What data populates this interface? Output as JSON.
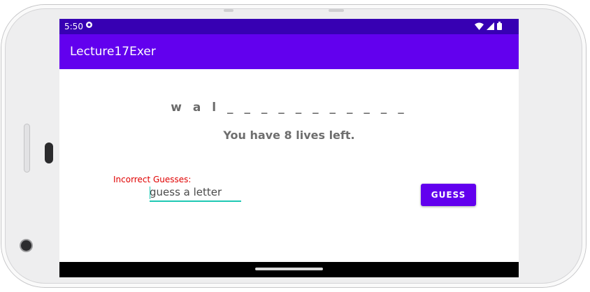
{
  "status_bar": {
    "time": "5:50"
  },
  "app_bar": {
    "title": "Lecture17Exer"
  },
  "game": {
    "word_display": "w a l _ _ _ _ _ _ _ _ _ _ _",
    "lives_text": "You have 8 lives left.",
    "incorrect_label": "Incorrect Guesses:",
    "input_placeholder": "guess a letter",
    "guess_button": "GUESS"
  },
  "colors": {
    "status_bar": "#3700b3",
    "app_bar": "#6200ee",
    "accent": "#1ec8b4",
    "error": "#e00000"
  },
  "icons": [
    "notification-icon",
    "wifi-icon",
    "signal-icon",
    "battery-icon"
  ]
}
